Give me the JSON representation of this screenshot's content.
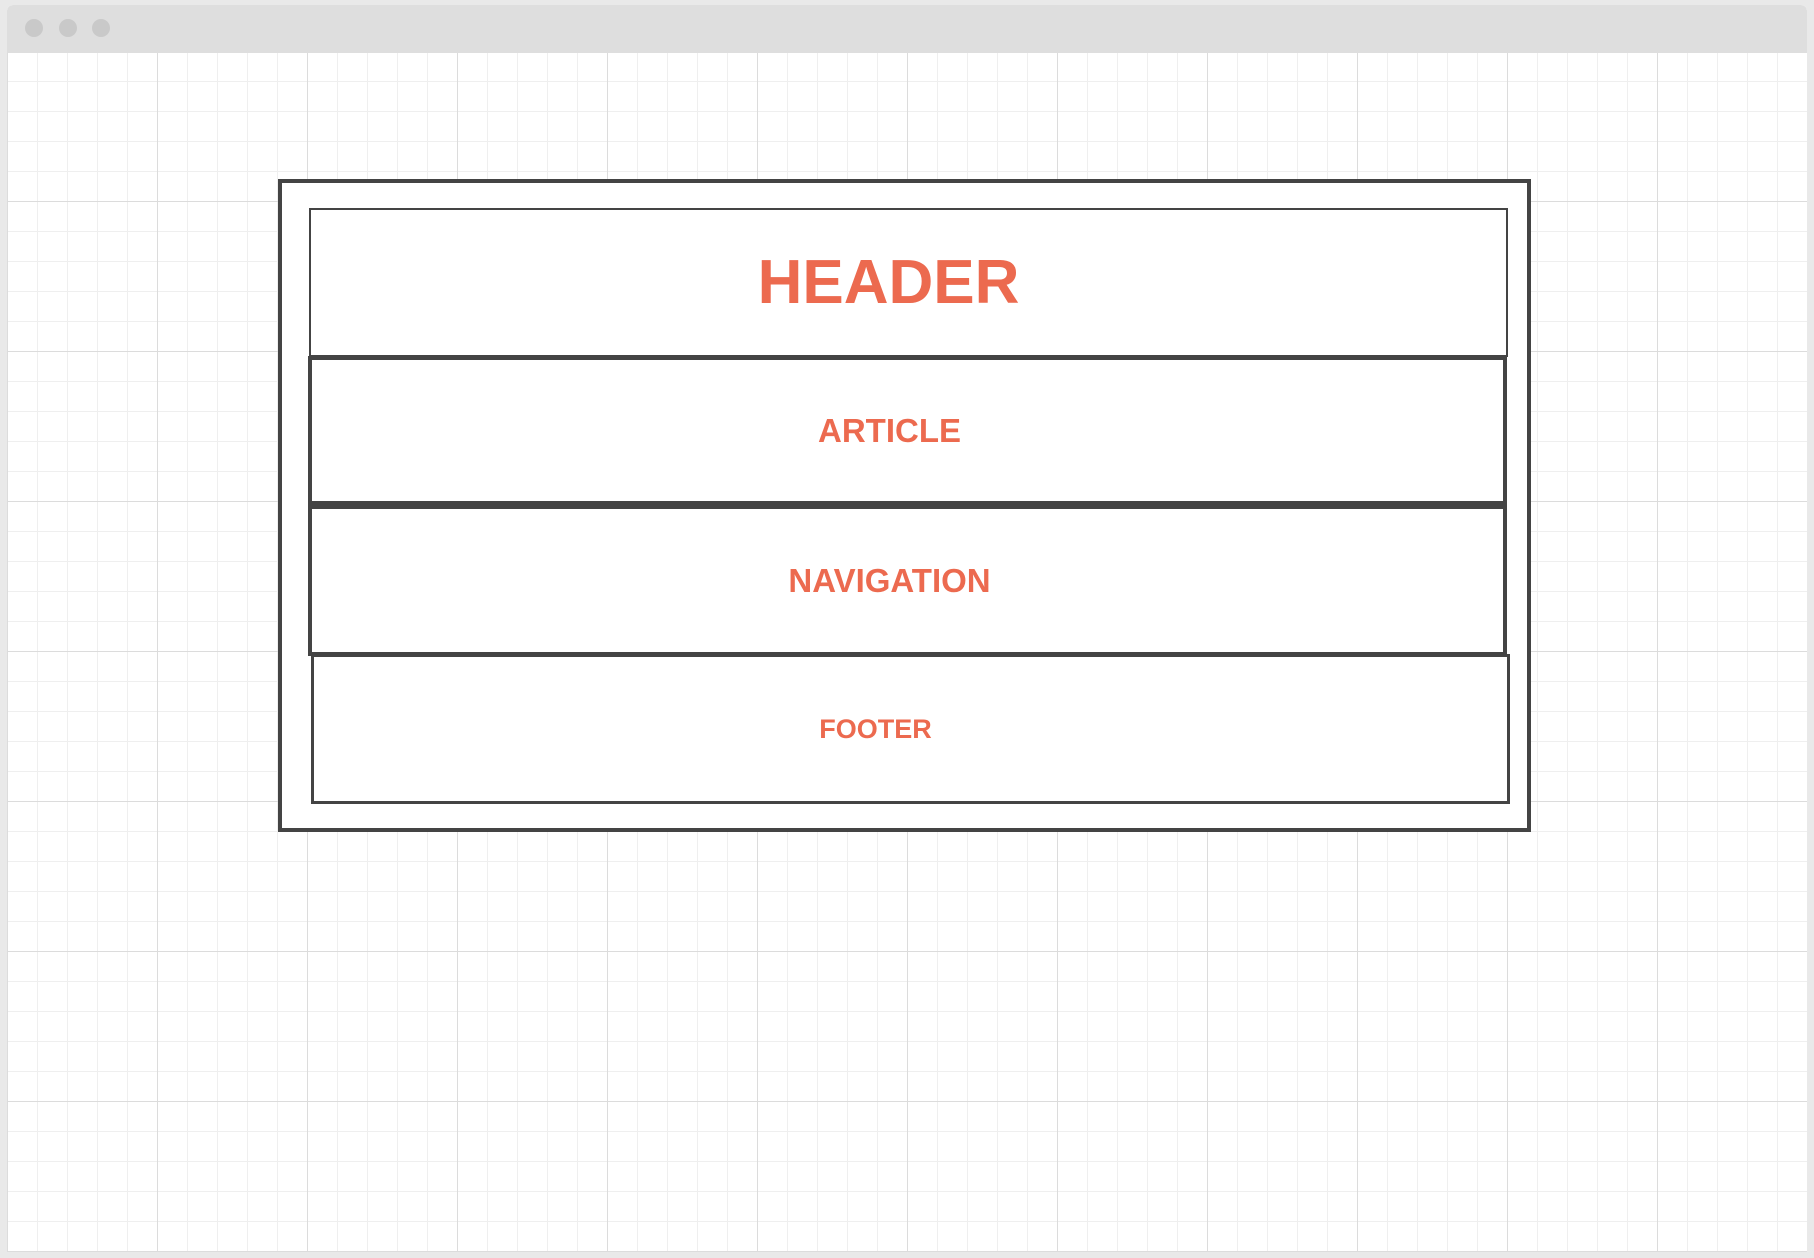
{
  "window": {
    "titlebar_dots": [
      "close-dot",
      "minimize-dot",
      "maximize-dot"
    ]
  },
  "diagram": {
    "blocks": {
      "header": "HEADER",
      "article": "ARTICLE",
      "navigation": "NAVIGATION",
      "footer": "FOOTER"
    },
    "colors": {
      "label": "#ec6a4f",
      "border": "#444444",
      "grid": "#dcdcdc",
      "titlebar": "#dedede"
    }
  }
}
